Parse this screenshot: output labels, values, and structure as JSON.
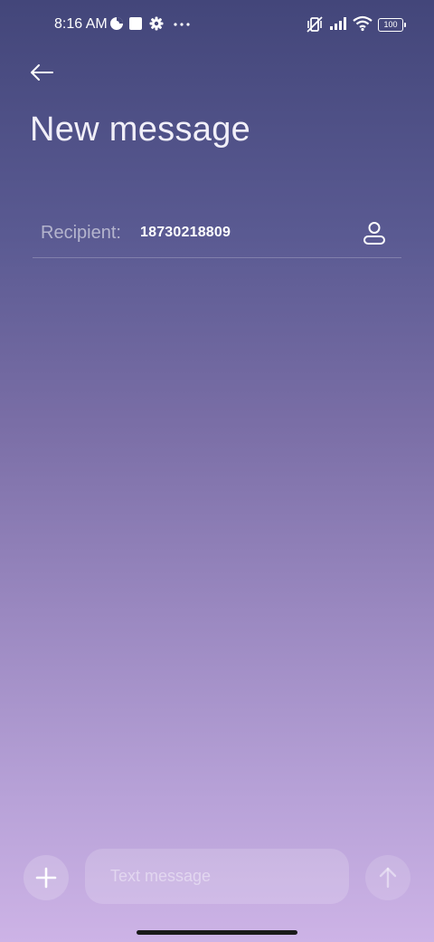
{
  "status_bar": {
    "time": "8:16 AM",
    "battery": "100",
    "left_icons": [
      "data-saver-icon",
      "square-notification-icon",
      "gear-icon",
      "more-dots-icon"
    ],
    "right_icons": [
      "vibrate-off-icon",
      "signal-icon",
      "wifi-icon",
      "battery-icon"
    ]
  },
  "header": {
    "back_icon": "arrow-left-icon",
    "title": "New message"
  },
  "recipient": {
    "label": "Recipient:",
    "value": "18730218809",
    "contact_icon": "person-icon"
  },
  "composer": {
    "add_icon": "plus-icon",
    "placeholder": "Text message",
    "value": "",
    "send_icon": "arrow-up-icon"
  },
  "colors": {
    "gradient_top": "#43467a",
    "gradient_bottom": "#cdb3e6"
  }
}
